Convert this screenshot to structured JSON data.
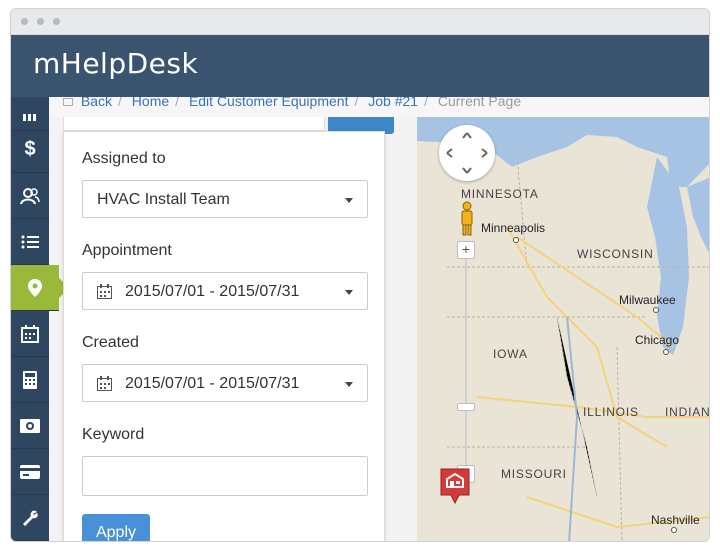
{
  "app": {
    "name": "mHelpDesk"
  },
  "breadcrumb": [
    {
      "label": "Back"
    },
    {
      "label": "Home"
    },
    {
      "label": "Edit Customer Equipment"
    },
    {
      "label": "Job #21"
    }
  ],
  "breadcrumb_current": "Current Page",
  "nav": [
    {
      "icon": "dashboard-icon"
    },
    {
      "icon": "dollar-icon"
    },
    {
      "icon": "users-icon"
    },
    {
      "icon": "list-icon"
    },
    {
      "icon": "map-marker-icon",
      "active": true
    },
    {
      "icon": "calendar-icon"
    },
    {
      "icon": "calculator-icon"
    },
    {
      "icon": "money-icon"
    },
    {
      "icon": "credit-card-icon"
    },
    {
      "icon": "wrench-icon"
    }
  ],
  "filters": {
    "assigned_to": {
      "label": "Assigned to",
      "value": "HVAC Install Team"
    },
    "appointment": {
      "label": "Appointment",
      "value": "2015/07/01 - 2015/07/31"
    },
    "created": {
      "label": "Created",
      "value": "2015/07/01 - 2015/07/31"
    },
    "keyword": {
      "label": "Keyword",
      "value": ""
    },
    "apply_label": "Apply"
  },
  "map": {
    "states": [
      "MINNESOTA",
      "WISCONSIN",
      "IOWA",
      "ILLINOIS",
      "INDIANA",
      "MISSOURI"
    ],
    "cities": [
      "Minneapolis",
      "Milwaukee",
      "Chicago",
      "Nashville"
    ],
    "controls": {
      "zoom_in": "+",
      "zoom_out": "−"
    }
  },
  "colors": {
    "header": "#3a5470",
    "nav": "#2f4660",
    "nav_active": "#9ab93a",
    "link": "#3a73b8",
    "primary_button": "#4a90d9",
    "lake": "#a7c3e4"
  }
}
